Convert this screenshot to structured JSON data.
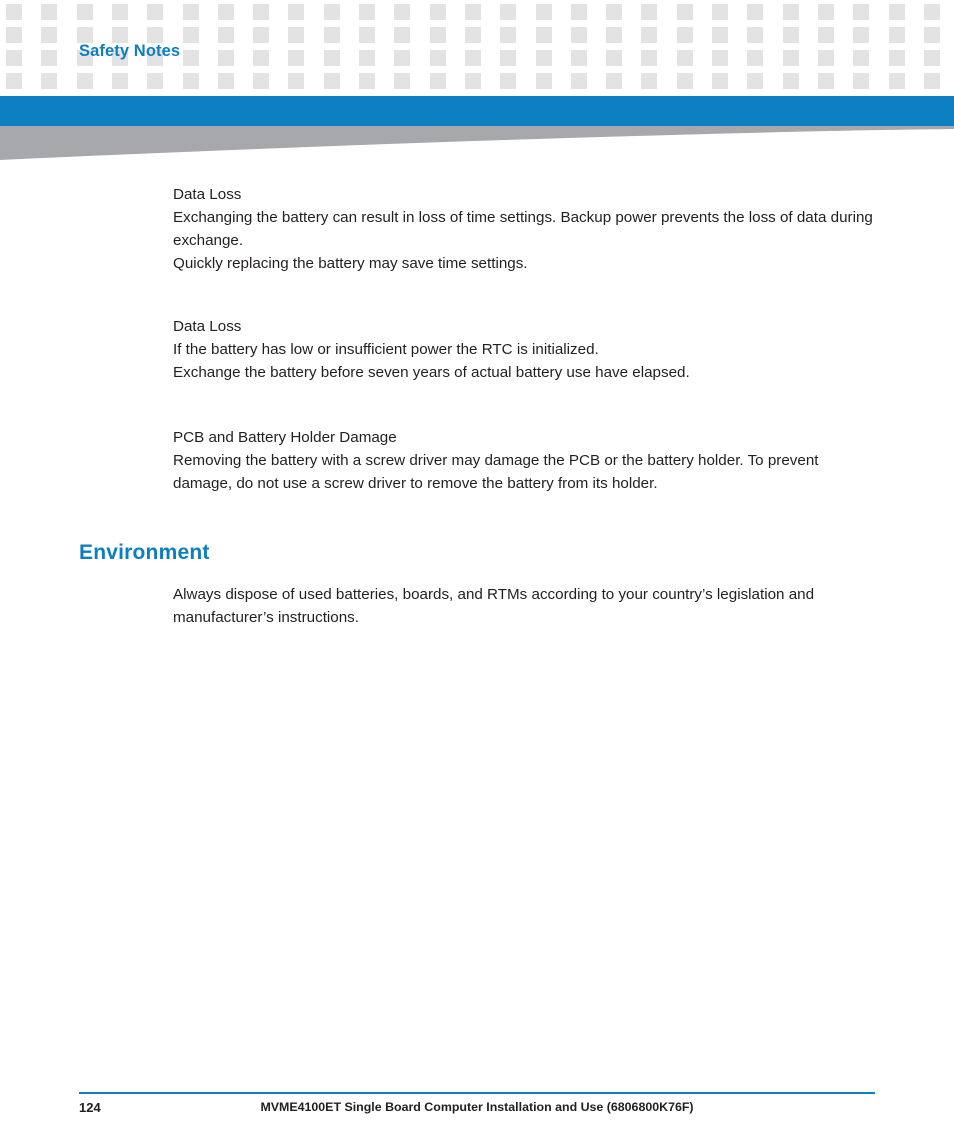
{
  "header": {
    "running_head": "Safety Notes",
    "accent_color": "#0d80c4",
    "dot_color": "#e3e3e3",
    "swoosh_color": "#a6a8ab"
  },
  "notes": [
    {
      "title": "Data Loss",
      "lines": [
        "Exchanging the battery can result in loss of time settings. Backup power prevents the loss of data during exchange.",
        "Quickly replacing the battery may save time settings."
      ]
    },
    {
      "title": "Data Loss",
      "lines": [
        "If the battery has low or insufficient power the RTC is initialized.",
        "Exchange the battery before seven years of actual battery use have elapsed."
      ]
    },
    {
      "title": "PCB and Battery Holder Damage",
      "lines": [
        "Removing the battery with a screw driver may damage the PCB or the battery holder. To prevent damage, do not use a screw driver to remove the battery from its holder."
      ]
    }
  ],
  "section": {
    "heading": "Environment",
    "paragraph": "Always dispose of used batteries, boards, and RTMs according to your country’s legislation and manufacturer’s instructions."
  },
  "footer": {
    "page_number": "124",
    "document_title": "MVME4100ET Single Board Computer Installation and Use (6806800K76F)"
  }
}
